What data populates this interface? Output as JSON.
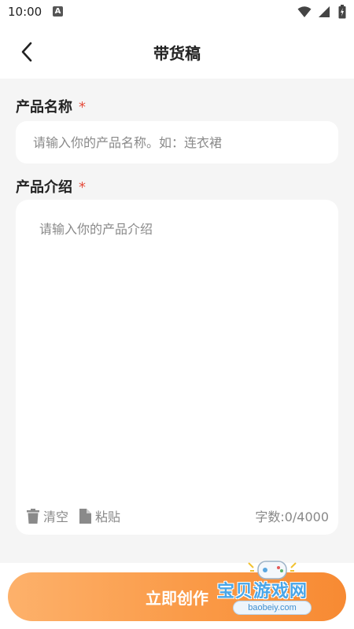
{
  "status_bar": {
    "time": "10:00",
    "notification_glyph": "A",
    "icons": [
      "wifi-icon",
      "signal-icon",
      "battery-icon"
    ]
  },
  "app_bar": {
    "title": "带货稿",
    "back_icon": "chevron-left-icon"
  },
  "form": {
    "product_name": {
      "label": "产品名称",
      "required": "*",
      "value": "",
      "placeholder": "请输入你的产品名称。如：连衣裙"
    },
    "product_intro": {
      "label": "产品介绍",
      "required": "*",
      "value": "",
      "placeholder": "请输入你的产品介绍",
      "actions": [
        {
          "icon": "trash-icon",
          "label": "清空"
        },
        {
          "icon": "document-icon",
          "label": "粘贴"
        }
      ],
      "word_count": "字数:0/4000"
    }
  },
  "primary_action": {
    "label": "立即创作"
  },
  "watermark": {
    "title": "宝贝游戏网",
    "url": "baobeiy.com"
  },
  "colors": {
    "accent_start": "#fdb16b",
    "accent_end": "#f78a33",
    "required": "#e54d3d",
    "background": "#f5f5f5"
  }
}
